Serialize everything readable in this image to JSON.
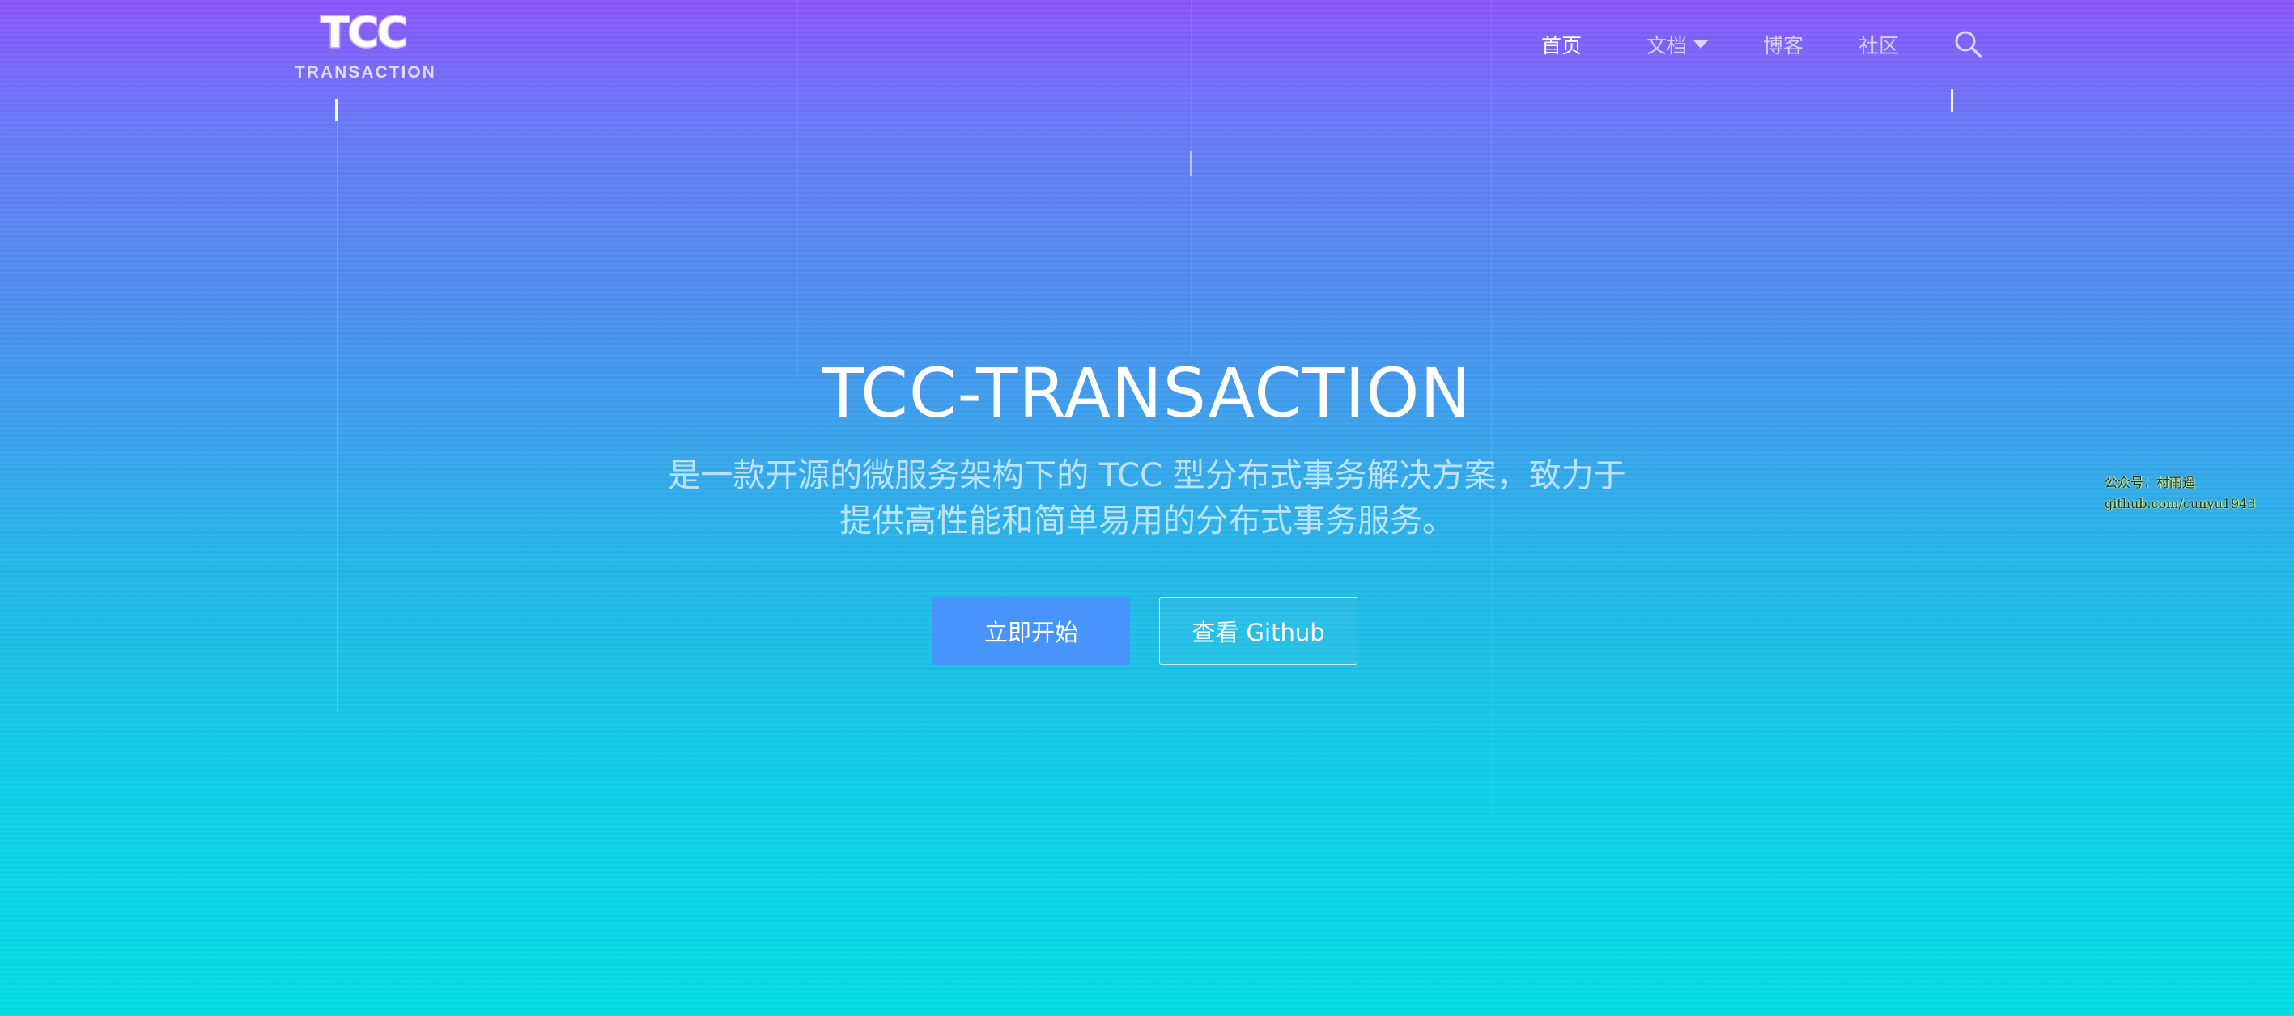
{
  "logo": {
    "mark": "TCC",
    "subtitle": "TRANSACTION"
  },
  "nav": {
    "items": [
      {
        "label": "首页",
        "active": true
      },
      {
        "label": "文档",
        "has_dropdown": true
      },
      {
        "label": "博客"
      },
      {
        "label": "社区"
      }
    ],
    "search_icon": "search-icon"
  },
  "hero": {
    "title": "TCC-TRANSACTION",
    "description_line1": "是一款开源的微服务架构下的 TCC 型分布式事务解决方案，致力于",
    "description_line2": "提供高性能和简单易用的分布式事务服务。",
    "primary_button": "立即开始",
    "secondary_button": "查看 Github"
  },
  "watermark": {
    "line1": "公众号：村雨遥",
    "line2": "github.com/cunyu1943"
  },
  "colors": {
    "gradient_top": "#8b57fc",
    "gradient_bottom": "#05dce4",
    "primary_button": "#4694fc",
    "text": "#ffffff"
  }
}
